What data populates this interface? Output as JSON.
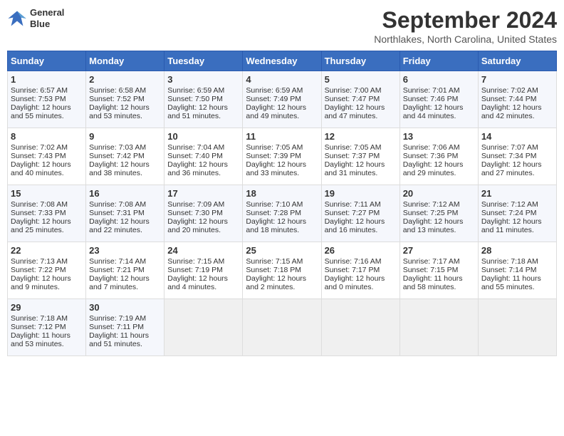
{
  "header": {
    "logo_line1": "General",
    "logo_line2": "Blue",
    "month": "September 2024",
    "location": "Northlakes, North Carolina, United States"
  },
  "days_of_week": [
    "Sunday",
    "Monday",
    "Tuesday",
    "Wednesday",
    "Thursday",
    "Friday",
    "Saturday"
  ],
  "weeks": [
    [
      {
        "day": "1",
        "lines": [
          "Sunrise: 6:57 AM",
          "Sunset: 7:53 PM",
          "Daylight: 12 hours",
          "and 55 minutes."
        ]
      },
      {
        "day": "2",
        "lines": [
          "Sunrise: 6:58 AM",
          "Sunset: 7:52 PM",
          "Daylight: 12 hours",
          "and 53 minutes."
        ]
      },
      {
        "day": "3",
        "lines": [
          "Sunrise: 6:59 AM",
          "Sunset: 7:50 PM",
          "Daylight: 12 hours",
          "and 51 minutes."
        ]
      },
      {
        "day": "4",
        "lines": [
          "Sunrise: 6:59 AM",
          "Sunset: 7:49 PM",
          "Daylight: 12 hours",
          "and 49 minutes."
        ]
      },
      {
        "day": "5",
        "lines": [
          "Sunrise: 7:00 AM",
          "Sunset: 7:47 PM",
          "Daylight: 12 hours",
          "and 47 minutes."
        ]
      },
      {
        "day": "6",
        "lines": [
          "Sunrise: 7:01 AM",
          "Sunset: 7:46 PM",
          "Daylight: 12 hours",
          "and 44 minutes."
        ]
      },
      {
        "day": "7",
        "lines": [
          "Sunrise: 7:02 AM",
          "Sunset: 7:44 PM",
          "Daylight: 12 hours",
          "and 42 minutes."
        ]
      }
    ],
    [
      {
        "day": "8",
        "lines": [
          "Sunrise: 7:02 AM",
          "Sunset: 7:43 PM",
          "Daylight: 12 hours",
          "and 40 minutes."
        ]
      },
      {
        "day": "9",
        "lines": [
          "Sunrise: 7:03 AM",
          "Sunset: 7:42 PM",
          "Daylight: 12 hours",
          "and 38 minutes."
        ]
      },
      {
        "day": "10",
        "lines": [
          "Sunrise: 7:04 AM",
          "Sunset: 7:40 PM",
          "Daylight: 12 hours",
          "and 36 minutes."
        ]
      },
      {
        "day": "11",
        "lines": [
          "Sunrise: 7:05 AM",
          "Sunset: 7:39 PM",
          "Daylight: 12 hours",
          "and 33 minutes."
        ]
      },
      {
        "day": "12",
        "lines": [
          "Sunrise: 7:05 AM",
          "Sunset: 7:37 PM",
          "Daylight: 12 hours",
          "and 31 minutes."
        ]
      },
      {
        "day": "13",
        "lines": [
          "Sunrise: 7:06 AM",
          "Sunset: 7:36 PM",
          "Daylight: 12 hours",
          "and 29 minutes."
        ]
      },
      {
        "day": "14",
        "lines": [
          "Sunrise: 7:07 AM",
          "Sunset: 7:34 PM",
          "Daylight: 12 hours",
          "and 27 minutes."
        ]
      }
    ],
    [
      {
        "day": "15",
        "lines": [
          "Sunrise: 7:08 AM",
          "Sunset: 7:33 PM",
          "Daylight: 12 hours",
          "and 25 minutes."
        ]
      },
      {
        "day": "16",
        "lines": [
          "Sunrise: 7:08 AM",
          "Sunset: 7:31 PM",
          "Daylight: 12 hours",
          "and 22 minutes."
        ]
      },
      {
        "day": "17",
        "lines": [
          "Sunrise: 7:09 AM",
          "Sunset: 7:30 PM",
          "Daylight: 12 hours",
          "and 20 minutes."
        ]
      },
      {
        "day": "18",
        "lines": [
          "Sunrise: 7:10 AM",
          "Sunset: 7:28 PM",
          "Daylight: 12 hours",
          "and 18 minutes."
        ]
      },
      {
        "day": "19",
        "lines": [
          "Sunrise: 7:11 AM",
          "Sunset: 7:27 PM",
          "Daylight: 12 hours",
          "and 16 minutes."
        ]
      },
      {
        "day": "20",
        "lines": [
          "Sunrise: 7:12 AM",
          "Sunset: 7:25 PM",
          "Daylight: 12 hours",
          "and 13 minutes."
        ]
      },
      {
        "day": "21",
        "lines": [
          "Sunrise: 7:12 AM",
          "Sunset: 7:24 PM",
          "Daylight: 12 hours",
          "and 11 minutes."
        ]
      }
    ],
    [
      {
        "day": "22",
        "lines": [
          "Sunrise: 7:13 AM",
          "Sunset: 7:22 PM",
          "Daylight: 12 hours",
          "and 9 minutes."
        ]
      },
      {
        "day": "23",
        "lines": [
          "Sunrise: 7:14 AM",
          "Sunset: 7:21 PM",
          "Daylight: 12 hours",
          "and 7 minutes."
        ]
      },
      {
        "day": "24",
        "lines": [
          "Sunrise: 7:15 AM",
          "Sunset: 7:19 PM",
          "Daylight: 12 hours",
          "and 4 minutes."
        ]
      },
      {
        "day": "25",
        "lines": [
          "Sunrise: 7:15 AM",
          "Sunset: 7:18 PM",
          "Daylight: 12 hours",
          "and 2 minutes."
        ]
      },
      {
        "day": "26",
        "lines": [
          "Sunrise: 7:16 AM",
          "Sunset: 7:17 PM",
          "Daylight: 12 hours",
          "and 0 minutes."
        ]
      },
      {
        "day": "27",
        "lines": [
          "Sunrise: 7:17 AM",
          "Sunset: 7:15 PM",
          "Daylight: 11 hours",
          "and 58 minutes."
        ]
      },
      {
        "day": "28",
        "lines": [
          "Sunrise: 7:18 AM",
          "Sunset: 7:14 PM",
          "Daylight: 11 hours",
          "and 55 minutes."
        ]
      }
    ],
    [
      {
        "day": "29",
        "lines": [
          "Sunrise: 7:18 AM",
          "Sunset: 7:12 PM",
          "Daylight: 11 hours",
          "and 53 minutes."
        ]
      },
      {
        "day": "30",
        "lines": [
          "Sunrise: 7:19 AM",
          "Sunset: 7:11 PM",
          "Daylight: 11 hours",
          "and 51 minutes."
        ]
      },
      {
        "day": "",
        "lines": []
      },
      {
        "day": "",
        "lines": []
      },
      {
        "day": "",
        "lines": []
      },
      {
        "day": "",
        "lines": []
      },
      {
        "day": "",
        "lines": []
      }
    ]
  ]
}
